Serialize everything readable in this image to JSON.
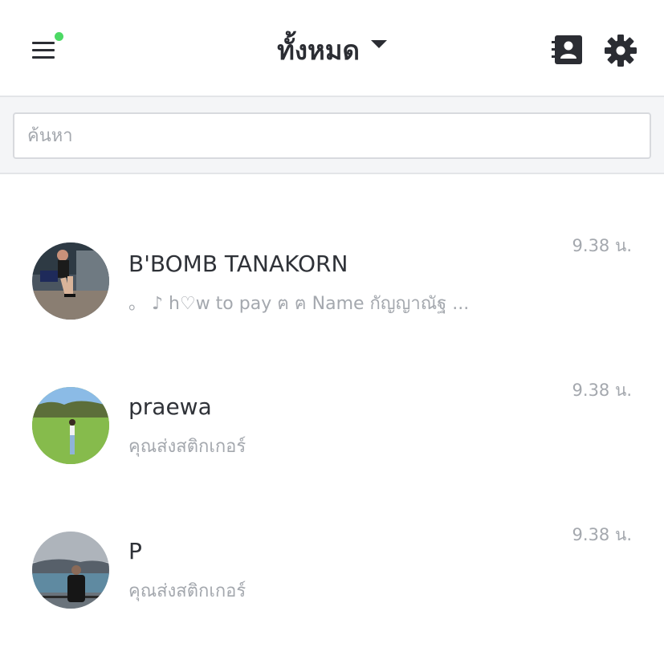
{
  "header": {
    "title": "ทั้งหมด",
    "notification_color": "#4cd964"
  },
  "search": {
    "placeholder": "ค้นหา",
    "value": ""
  },
  "chats": [
    {
      "name": "B'BOMB TANAKORN",
      "preview": "。  ♪ h♡w to pay ฅ ฅ Name กัญญาณัฐ ...",
      "time": "9.38 น."
    },
    {
      "name": "praewa",
      "preview": "คุณส่งสติกเกอร์",
      "time": "9.38 น."
    },
    {
      "name": "P",
      "preview": "คุณส่งสติกเกอร์",
      "time": "9.38 น."
    }
  ]
}
